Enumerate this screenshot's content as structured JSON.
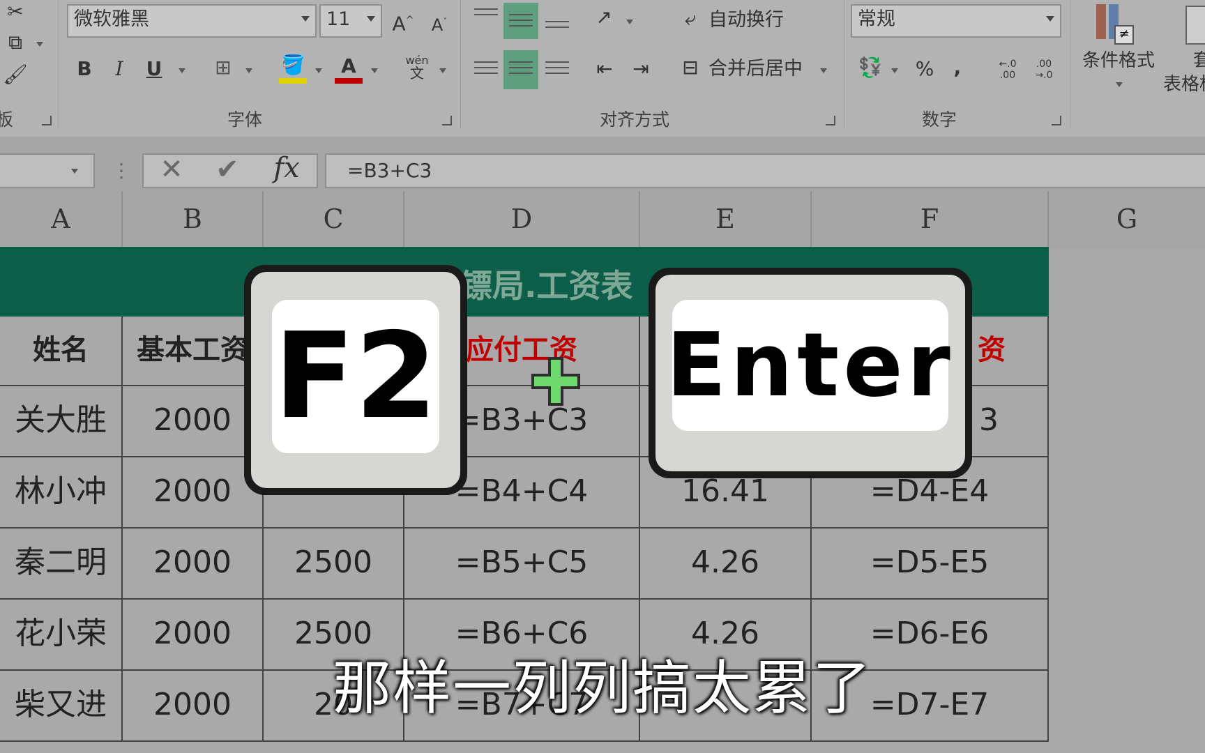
{
  "ribbon": {
    "font_name": "微软雅黑",
    "font_size": "11",
    "grow_font": "A",
    "shrink_font": "A",
    "bold": "B",
    "italic": "I",
    "underline": "U",
    "font_color_letter": "A",
    "wen_label": "wén",
    "wen_char": "文",
    "wrap_text": "自动换行",
    "merge_center": "合并后居中",
    "number_format": "常规",
    "percent": "%",
    "comma": ",",
    "inc_decimal": "←.0 .00",
    "dec_decimal": ".00 →.0",
    "conditional_format": "条件格式",
    "table_format_partial": "套",
    "table_format_label": "表格格",
    "group_font": "字体",
    "group_align": "对齐方式",
    "group_number": "数字",
    "group_clipboard_partial": "板",
    "accent_green": "#5f9f7f",
    "font_color_bar": "#c00000",
    "fill_color_bar": "#e0d200"
  },
  "formula_bar": {
    "formula": "=B3+C3",
    "fx": "fx"
  },
  "columns": [
    "A",
    "B",
    "C",
    "D",
    "E",
    "F",
    "G"
  ],
  "sheet": {
    "title_visible": "镖局.工资表",
    "header": [
      "姓名",
      "基本工资",
      "",
      "应付工资",
      "",
      "资"
    ],
    "rows": [
      [
        "关大胜",
        "2000",
        "",
        "=B3+C3",
        "",
        "3"
      ],
      [
        "林小冲",
        "2000",
        "",
        "=B4+C4",
        "16.41",
        "=D4-E4"
      ],
      [
        "秦二明",
        "2000",
        "2500",
        "=B5+C5",
        "4.26",
        "=D5-E5"
      ],
      [
        "花小荣",
        "2000",
        "2500",
        "=B6+C6",
        "4.26",
        "=D6-E6"
      ],
      [
        "柴又进",
        "2000",
        "20",
        "=B7+C7",
        "",
        "=D7-E7"
      ]
    ],
    "header_color": "#c00000",
    "title_band_color": "#0d5f49"
  },
  "overlay": {
    "key_left": "F2",
    "key_right": "Enter",
    "subtitle": "那样一列列搞太累了"
  }
}
